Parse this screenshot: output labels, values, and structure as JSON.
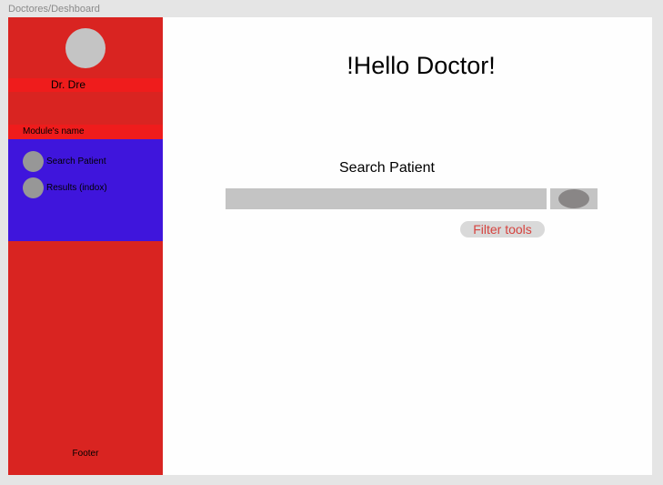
{
  "frame": {
    "title": "Doctores/Deshboard"
  },
  "sidebar": {
    "user_name": "Dr. Dre",
    "module_name": "Module's name",
    "menu": [
      {
        "label": "Search Patient"
      },
      {
        "label": "Results (indox)"
      }
    ],
    "footer": "Footer"
  },
  "main": {
    "greeting": "!Hello Doctor!",
    "search": {
      "title": "Search Patient",
      "input_value": "",
      "placeholder": ""
    },
    "filter_label": "Filter tools"
  },
  "colors": {
    "sidebar": "#d92421",
    "sidebar_highlight": "#ef1c1c",
    "menu_bg": "#3f15dc",
    "placeholder_gray": "#c4c4c4",
    "filter_text": "#d6433f"
  }
}
